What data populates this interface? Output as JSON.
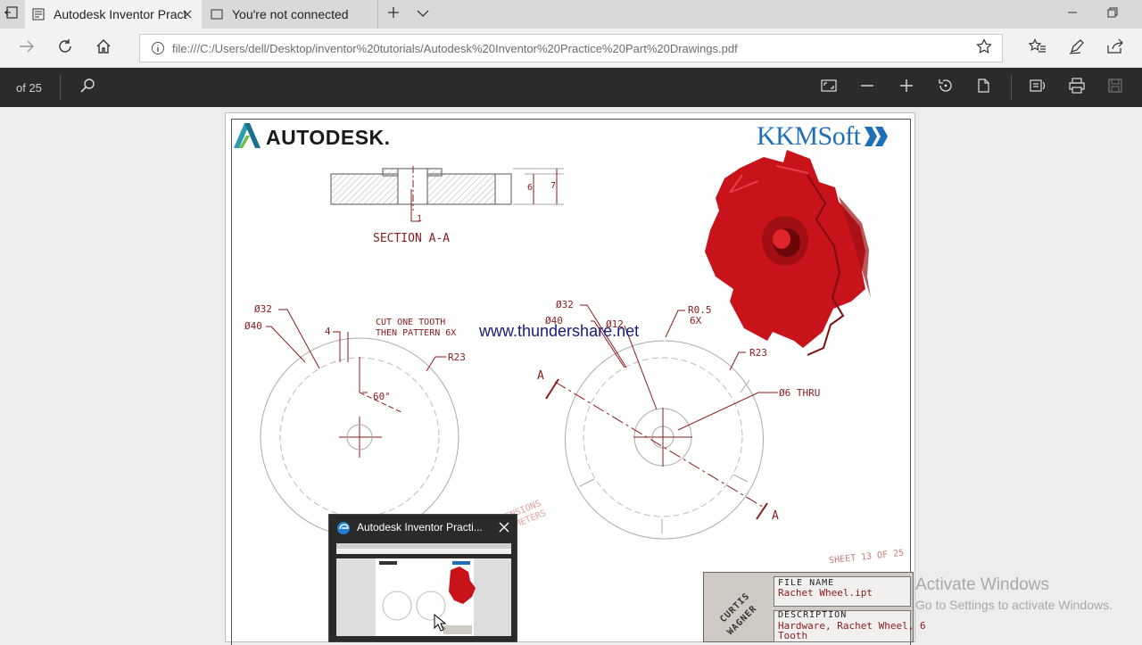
{
  "tabs": [
    {
      "title": "Autodesk Inventor Pract",
      "active": true
    },
    {
      "title": "You're not connected",
      "active": false
    }
  ],
  "address": {
    "url": "file:///C:/Users/dell/Desktop/inventor%20tutorials/Autodesk%20Inventor%20Practice%20Part%20Drawings.pdf"
  },
  "pdf_toolbar": {
    "page_of": "of 25"
  },
  "document": {
    "brand_left": "AUTODESK.",
    "brand_right": "KKMSoft",
    "watermark": "www.thundershare.net",
    "section_label": "SECTION A-A",
    "dims": {
      "d32_left": "Ø32",
      "d40_left": "Ø40",
      "four": "4",
      "cut_note_1": "CUT ONE TOOTH",
      "cut_note_2": "THEN PATTERN 6X",
      "r23_left": "R23",
      "sixty": "60°",
      "d32_right": "Ø32",
      "d40_right": "Ø40",
      "d12": "Ø12",
      "r05": "R0.5",
      "sixx": "6X",
      "r23_right": "R23",
      "d6thru": "Ø6 THRU",
      "a_top": "A",
      "a_bottom": "A",
      "six": "6",
      "seven": "7",
      "one": "1",
      "faded_1": "DIMENSIONS",
      "faded_2": "MILLIMETERS"
    },
    "sheet": "SHEET 13 OF 25",
    "title_block": {
      "file_label": "FILE NAME",
      "file_value": "Rachet Wheel.ipt",
      "desc_label": "DESCRIPTION",
      "desc_value_1": "Hardware, Rachet Wheel, 6",
      "desc_value_2": "Tooth",
      "stamp_1": "CURTIS",
      "stamp_2": "WAGNER"
    }
  },
  "activation": {
    "line1": "Activate Windows",
    "line2": "Go to Settings to activate Windows."
  },
  "thumbnail": {
    "title": "Autodesk Inventor Practi..."
  },
  "colors": {
    "tab_strip": "#d9d9d9",
    "pdf_toolbar": "#2b2b2b",
    "drawing_red": "#8a1b1b",
    "part_red": "#c8131a",
    "kkm_blue": "#1e6fb8"
  }
}
